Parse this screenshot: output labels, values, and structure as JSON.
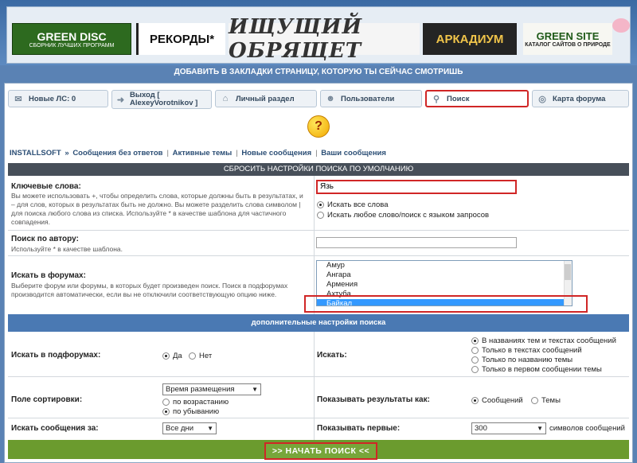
{
  "banner": {
    "logos": [
      {
        "title": "GREEN DISC",
        "subtitle": "СБОРНИК ЛУЧШИХ ПРОГРАММ"
      },
      {
        "title": "РЕКОРДЫ"
      },
      {
        "title": "ИЩУЩИЙ ОБРЯЩЕТ"
      },
      {
        "title": "АРКАДИУМ"
      },
      {
        "title": "GREEN SITE",
        "subtitle": "КАТАЛОГ САЙТОВ О ПРИРОДЕ"
      }
    ]
  },
  "bookmark_text": "ДОБАВИТЬ В ЗАКЛАДКИ СТРАНИЦУ, КОТОРУЮ ТЫ СЕЙЧАС СМОТРИШЬ",
  "nav": {
    "tabs": [
      {
        "label": "Новые ЛС: 0",
        "icon": "envelope-icon"
      },
      {
        "label": "Выход [ AlexeyVorotnikov ]",
        "icon": "exit-icon"
      },
      {
        "label": "Личный раздел",
        "icon": "home-icon"
      },
      {
        "label": "Пользователи",
        "icon": "users-icon"
      },
      {
        "label": "Поиск",
        "icon": "search-icon"
      },
      {
        "label": "Карта форума",
        "icon": "map-icon"
      }
    ]
  },
  "breadcrumbs": [
    "INSTALLSOFT",
    "»",
    "Сообщения без ответов",
    "Активные темы",
    "Новые сообщения",
    "Ваши сообщения"
  ],
  "reset_label": "СБРОСИТЬ НАСТРОЙКИ ПОИСКА ПО УМОЛЧАНИЮ",
  "keywords": {
    "label": "Ключевые слова:",
    "help": "Вы можете использовать +, чтобы определить слова, которые должны быть в результатах, и – для слов, которых в результатах быть не должно. Вы можете разделить слова символом | для поиска любого слова из списка. Используйте * в качестве шаблона для частичного совпадения.",
    "value": "Язь",
    "options": [
      "Искать все слова",
      "Искать любое слово/поиск с языком запросов"
    ]
  },
  "author": {
    "label": "Поиск по автору:",
    "help": "Используйте * в качестве шаблона."
  },
  "forums": {
    "label": "Искать в форумах:",
    "help": "Выберите форум или форумы, в которых будет произведен поиск. Поиск в подфорумах производится автоматически, если вы не отключили соответствующую опцию ниже.",
    "items": [
      "Амур",
      "Ангара",
      "Армения",
      "Ахтуба",
      "Байкал"
    ],
    "selected": "Байкал"
  },
  "advanced_label": "дополнительные настройки поиска",
  "subforums": {
    "label": "Искать в подфорумах:",
    "yes": "Да",
    "no": "Нет"
  },
  "search_in": {
    "label": "Искать:",
    "options": [
      "В названиях тем и текстах сообщений",
      "Только в текстах сообщений",
      "Только по названию темы",
      "Только в первом сообщении темы"
    ]
  },
  "sort": {
    "label": "Поле сортировки:",
    "selected": "Время размещения",
    "asc": "по возрастанию",
    "desc": "по убыванию"
  },
  "show_as": {
    "label": "Показывать результаты как:",
    "posts": "Сообщений",
    "topics": "Темы"
  },
  "period": {
    "label": "Искать сообщения за:",
    "selected": "Все дни"
  },
  "show_first": {
    "label": "Показывать первые:",
    "selected": "300",
    "suffix": "символов сообщений"
  },
  "go_label": ">> НАЧАТЬ ПОИСК <<"
}
